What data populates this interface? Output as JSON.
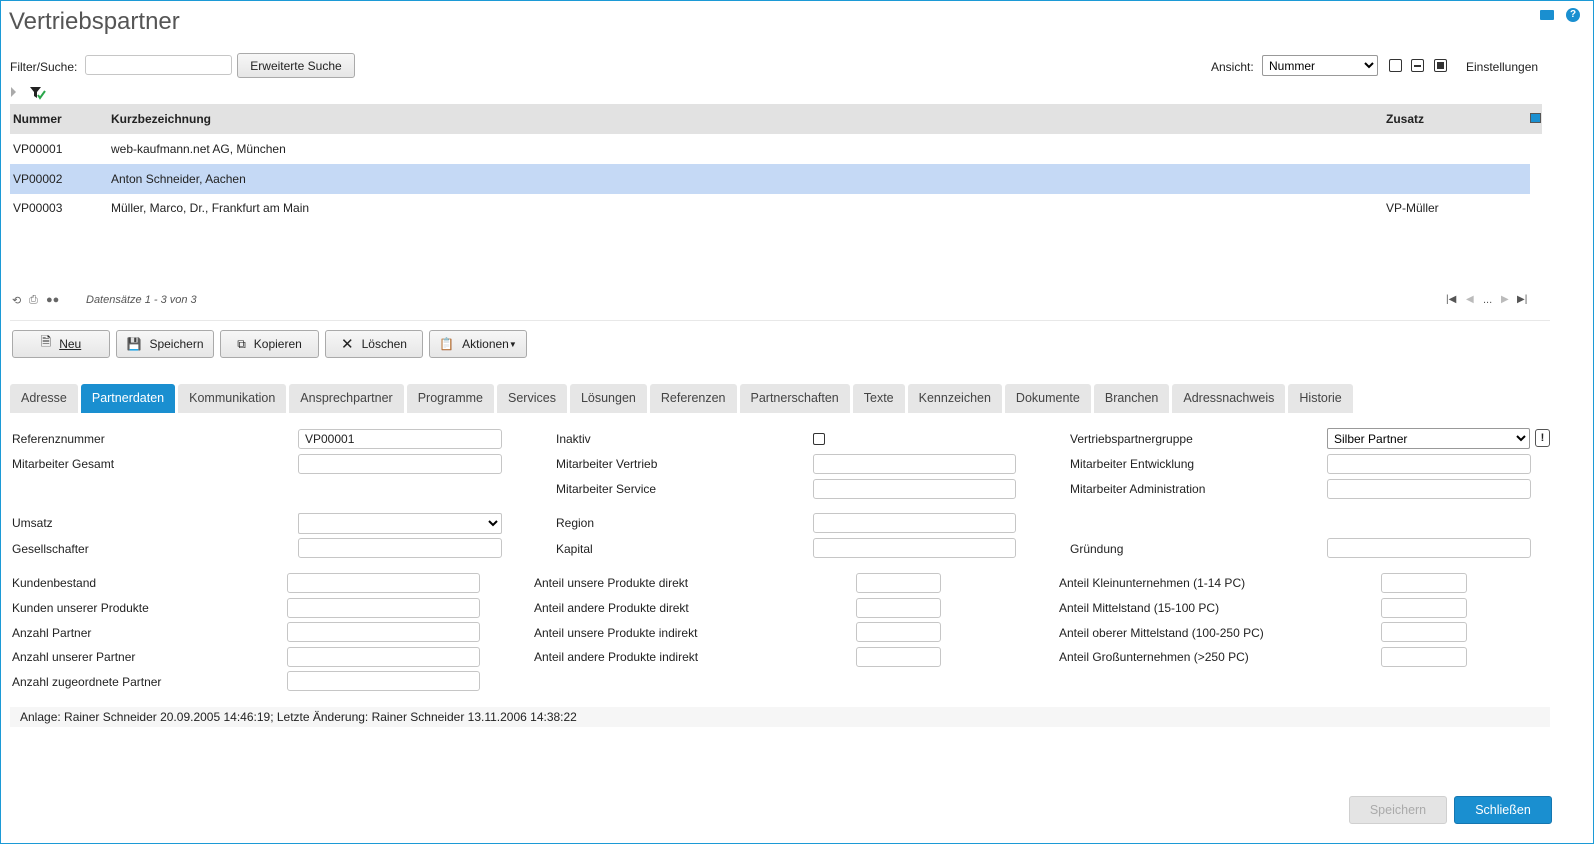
{
  "header": {
    "title": "Vertriebspartner"
  },
  "filter": {
    "label": "Filter/Suche:",
    "value": "",
    "extended_search": "Erweiterte Suche"
  },
  "view": {
    "label": "Ansicht:",
    "selected": "Nummer",
    "settings": "Einstellungen"
  },
  "grid": {
    "columns": [
      "Nummer",
      "Kurzbezeichnung",
      "Zusatz"
    ],
    "rows": [
      [
        "VP00001",
        "web-kaufmann.net AG, München",
        ""
      ],
      [
        "VP00002",
        "Anton Schneider, Aachen",
        ""
      ],
      [
        "VP00003",
        "Müller, Marco, Dr., Frankfurt am Main",
        "VP-Müller"
      ]
    ],
    "selected_row": 1,
    "record_info": "Datensätze 1 - 3 von 3",
    "pager_ellipsis": "..."
  },
  "toolbar": {
    "new": "Neu",
    "save": "Speichern",
    "copy": "Kopieren",
    "delete": "Löschen",
    "actions": "Aktionen"
  },
  "tabs": [
    "Adresse",
    "Partnerdaten",
    "Kommunikation",
    "Ansprechpartner",
    "Programme",
    "Services",
    "Lösungen",
    "Referenzen",
    "Partnerschaften",
    "Texte",
    "Kennzeichen",
    "Dokumente",
    "Branchen",
    "Adressnachweis",
    "Historie"
  ],
  "active_tab": 1,
  "form": {
    "referenznummer": {
      "label": "Referenznummer",
      "value": "VP00001"
    },
    "inaktiv": {
      "label": "Inaktiv",
      "checked": false
    },
    "vertriebspartnergruppe": {
      "label": "Vertriebspartnergruppe",
      "value": "Silber Partner"
    },
    "mitarbeiter_gesamt": {
      "label": "Mitarbeiter Gesamt",
      "value": ""
    },
    "mitarbeiter_vertrieb": {
      "label": "Mitarbeiter Vertrieb",
      "value": ""
    },
    "mitarbeiter_entwicklung": {
      "label": "Mitarbeiter Entwicklung",
      "value": ""
    },
    "mitarbeiter_service": {
      "label": "Mitarbeiter Service",
      "value": ""
    },
    "mitarbeiter_administration": {
      "label": "Mitarbeiter Administration",
      "value": ""
    },
    "umsatz": {
      "label": "Umsatz",
      "value": ""
    },
    "region": {
      "label": "Region",
      "value": ""
    },
    "gesellschafter": {
      "label": "Gesellschafter",
      "value": ""
    },
    "kapital": {
      "label": "Kapital",
      "value": ""
    },
    "gruendung": {
      "label": "Gründung",
      "value": ""
    },
    "kundenbestand": {
      "label": "Kundenbestand",
      "value": ""
    },
    "kunden_unserer_produkte": {
      "label": "Kunden unserer Produkte",
      "value": ""
    },
    "anzahl_partner": {
      "label": "Anzahl Partner",
      "value": ""
    },
    "anzahl_unserer_partner": {
      "label": "Anzahl unserer Partner",
      "value": ""
    },
    "anzahl_zugeordnete_partner": {
      "label": "Anzahl zugeordnete Partner",
      "value": ""
    },
    "anteil_unsere_direkt": {
      "label": "Anteil unsere Produkte direkt",
      "value": ""
    },
    "anteil_andere_direkt": {
      "label": "Anteil andere Produkte direkt",
      "value": ""
    },
    "anteil_unsere_indirekt": {
      "label": "Anteil unsere Produkte indirekt",
      "value": ""
    },
    "anteil_andere_indirekt": {
      "label": "Anteil andere Produkte indirekt",
      "value": ""
    },
    "anteil_klein": {
      "label": "Anteil Kleinunternehmen (1-14 PC)",
      "value": ""
    },
    "anteil_mittel": {
      "label": "Anteil Mittelstand (15-100 PC)",
      "value": ""
    },
    "anteil_oberer_mittel": {
      "label": "Anteil oberer Mittelstand (100-250 PC)",
      "value": ""
    },
    "anteil_gross": {
      "label": "Anteil Großunternehmen (>250 PC)",
      "value": ""
    }
  },
  "status": "Anlage: Rainer Schneider 20.09.2005 14:46:19; Letzte Änderung: Rainer Schneider 13.11.2006 14:38:22",
  "bottom": {
    "save": "Speichern",
    "close": "Schließen"
  },
  "colors": {
    "accent": "#1a8fd0",
    "selected_row": "#c5d9f5",
    "header_bg": "#e2e2e2"
  }
}
